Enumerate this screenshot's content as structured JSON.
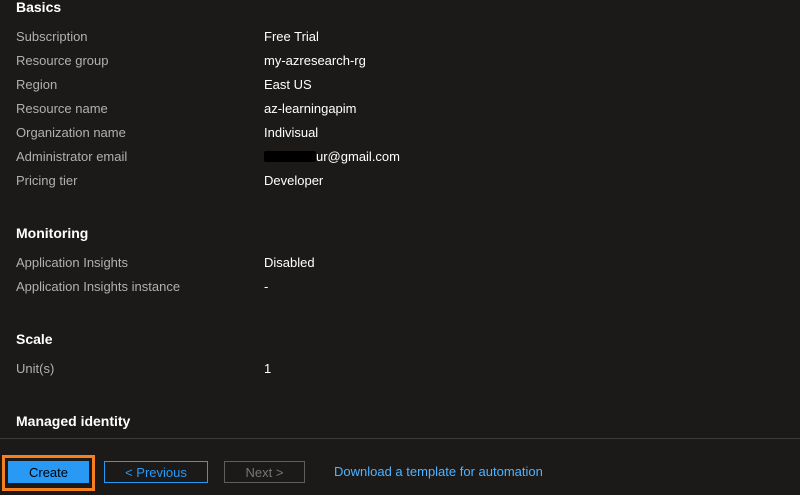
{
  "basics": {
    "title": "Basics",
    "rows": [
      {
        "label": "Subscription",
        "value": "Free Trial"
      },
      {
        "label": "Resource group",
        "value": "my-azresearch-rg"
      },
      {
        "label": "Region",
        "value": "East US"
      },
      {
        "label": "Resource name",
        "value": "az-learningapim"
      },
      {
        "label": "Organization name",
        "value": "Indivisual"
      },
      {
        "label": "Administrator email",
        "value": "ur@gmail.com"
      },
      {
        "label": "Pricing tier",
        "value": "Developer"
      }
    ]
  },
  "monitoring": {
    "title": "Monitoring",
    "rows": [
      {
        "label": "Application Insights",
        "value": "Disabled"
      },
      {
        "label": "Application Insights instance",
        "value": "-"
      }
    ]
  },
  "scale": {
    "title": "Scale",
    "rows": [
      {
        "label": "Unit(s)",
        "value": "1"
      }
    ]
  },
  "managed_identity": {
    "title": "Managed identity"
  },
  "footer": {
    "create_label": "Create",
    "previous_label": "< Previous",
    "next_label": "Next >",
    "template_link": "Download a template for automation"
  },
  "colors": {
    "background": "#1b1a19",
    "accent": "#2899f5",
    "highlight": "#f7801e",
    "label": "#b3b0ad"
  }
}
